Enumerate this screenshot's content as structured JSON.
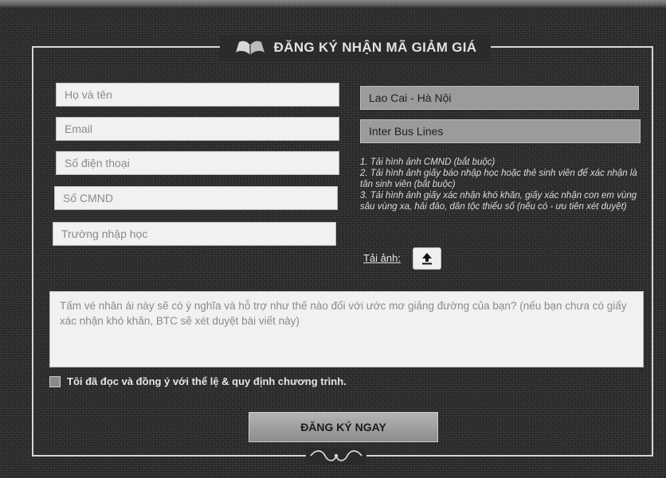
{
  "form": {
    "title": "ĐĂNG KÝ NHẬN MÃ GIẢM GIÁ",
    "title_icon": "open-book-icon",
    "fields": {
      "full_name_placeholder": "Họ và tên",
      "email_placeholder": "Email",
      "phone_placeholder": "Số điện thoại",
      "id_card_placeholder": "Số CMND",
      "school_placeholder": "Trường nhập học"
    },
    "route_value": "Lao Cai - Hà Nội",
    "bus_line_value": "Inter Bus Lines",
    "instructions": [
      "1. Tải hình ảnh CMND (bắt buộc)",
      "2. Tải hình ảnh giấy báo nhập học hoặc thẻ sinh viên để xác nhận là tân sinh viên (bắt buộc)",
      "3. Tải hình ảnh giấy xác nhận khó khăn, giấy xác nhận con em vùng sâu vùng xa, hải đảo, dân tộc thiểu số (nếu có - ưu tiên xét duyệt)"
    ],
    "upload_label": "Tải ảnh:",
    "upload_icon": "upload-arrow-icon",
    "story_placeholder": "Tấm vé nhân ái này sẽ có ý nghĩa và hỗ trợ như thế nào đối với ước mơ giảng đường của bạn? (nếu bạn chưa có giấy xác nhận khó khăn, BTC sẽ xét duyệt bài viết này)",
    "agree_label": "Tôi đã đọc và đồng ý với thể lệ & quy định chương trình.",
    "submit_label": "ĐĂNG KÝ NGAY",
    "ornament_icon": "flourish-ornament-icon"
  },
  "colors": {
    "background": "#2b2b2b",
    "frame": "#d6d6d6",
    "field": "#f1f1f1",
    "field_dark": "#9b9b9b",
    "button": "#a0a0a0"
  }
}
